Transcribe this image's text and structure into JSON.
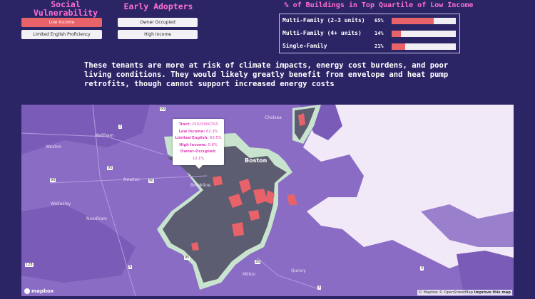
{
  "social": {
    "title": "Social Vulnerability",
    "buttons": [
      "Low Income",
      "Limited English Proficiency"
    ]
  },
  "early": {
    "title": "Early Adopters",
    "buttons": [
      "Owner Occupied",
      "High Income"
    ]
  },
  "bars": {
    "title": "% of Buildings in Top Quartile of Low Income",
    "rows": [
      {
        "label": "Multi-Family (2-3 units)",
        "pct_text": "65%",
        "pct": 0.65
      },
      {
        "label": "Multi-Family (4+ units)",
        "pct_text": "14%",
        "pct": 0.14
      },
      {
        "label": "Single-Family",
        "pct_text": "21%",
        "pct": 0.21
      }
    ]
  },
  "description": "These tenants are more at risk of climate impacts, energy cost burdens, and poor living conditions. They would likely greatly benefit from envelope and heat pump retrofits, though cannot support increased energy costs",
  "tooltip": {
    "tract_label": "Tract:",
    "tract_value": "25025000703",
    "low_label": "Low Income:",
    "low_value": "62.3%",
    "english_label": "Limited English:",
    "english_value": "63.5%",
    "high_label": "High Income:",
    "high_value": "0.8%",
    "owner_label": "Owner-Occupied:",
    "owner_value": "10.1%"
  },
  "map": {
    "places": [
      "Chelsea",
      "Waltham",
      "Weston",
      "Newton",
      "Brookline",
      "Boston",
      "Wellesley",
      "Needham",
      "Milton",
      "Quincy"
    ],
    "routes": [
      "60",
      "2",
      "95",
      "90",
      "90",
      "9",
      "95",
      "28",
      "3",
      "128",
      "3"
    ],
    "logo": "mapbox",
    "attribution_plain": "© Mapbox © OpenStreetMap",
    "attribution_bold": "Improve this map"
  },
  "colors": {
    "accent": "#ff6fd0",
    "bar": "#e8626a",
    "background": "#2b2566"
  }
}
